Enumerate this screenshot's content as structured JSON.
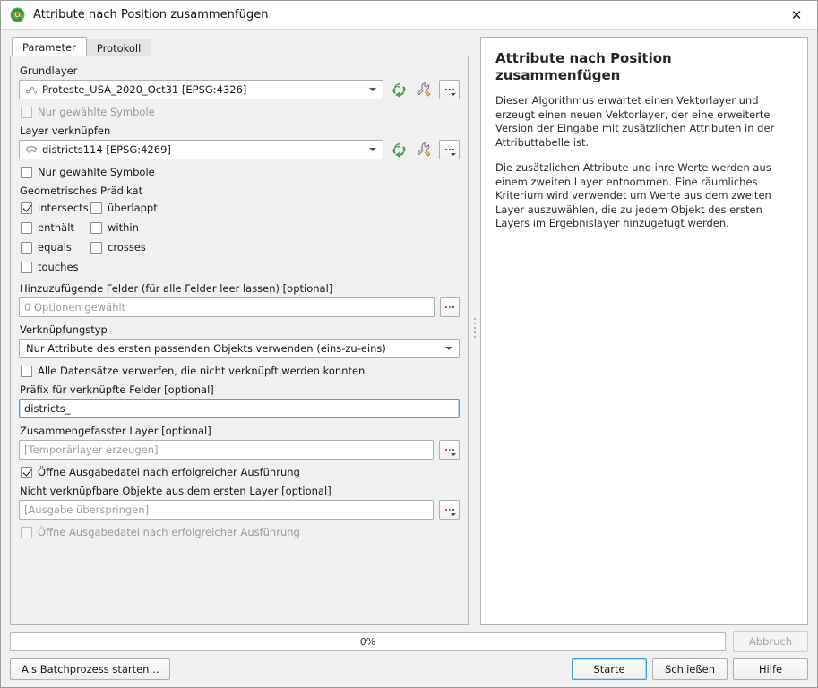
{
  "window": {
    "title": "Attribute nach Position zusammenfügen",
    "icon": "qgis-logo-icon",
    "close_label": "✕"
  },
  "tabs": [
    {
      "label": "Parameter",
      "active": true
    },
    {
      "label": "Protokoll",
      "active": false
    }
  ],
  "parameters": {
    "base_layer": {
      "label": "Grundlayer",
      "value": "Proteste_USA_2020_Oct31 [EPSG:4326]",
      "geometry_icon": "point-layer-icon",
      "refresh_icon": "refresh-icon",
      "expression_icon": "wrench-icon",
      "options_icon": "dots-menu-icon"
    },
    "base_selected_only": {
      "label": "Nur gewählte Symbole",
      "checked": false,
      "disabled": true
    },
    "join_layer": {
      "label": "Layer verknüpfen",
      "value": "districts114 [EPSG:4269]",
      "geometry_icon": "polygon-layer-icon",
      "refresh_icon": "refresh-icon",
      "expression_icon": "wrench-icon",
      "options_icon": "dots-menu-icon"
    },
    "join_selected_only": {
      "label": "Nur gewählte Symbole",
      "checked": false,
      "disabled": false
    },
    "predicate": {
      "label": "Geometrisches Prädikat",
      "items": [
        {
          "label": "intersects",
          "checked": true
        },
        {
          "label": "überlappt",
          "checked": false
        },
        {
          "label": "enthält",
          "checked": false
        },
        {
          "label": "within",
          "checked": false
        },
        {
          "label": "equals",
          "checked": false
        },
        {
          "label": "crosses",
          "checked": false
        },
        {
          "label": "touches",
          "checked": false
        }
      ]
    },
    "fields_to_add": {
      "label": "Hinzuzufügende Felder (für alle Felder leer lassen) [optional]",
      "value": "0 Optionen gewählt",
      "is_placeholder": true,
      "browse_icon": "dots-menu-icon"
    },
    "join_type": {
      "label": "Verknüpfungstyp",
      "value": "Nur Attribute des ersten passenden Objekts verwenden (eins-zu-eins)"
    },
    "discard_unmatched": {
      "label": "Alle Datensätze verwerfen, die nicht verknüpft werden konnten",
      "checked": false,
      "disabled": false
    },
    "prefix": {
      "label": "Präfix für verknüpfte Felder [optional]",
      "value": "districts_",
      "focused": true
    },
    "joined_layer": {
      "label": "Zusammengefasster Layer [optional]",
      "value": "[Temporärlayer erzeugen]",
      "is_placeholder": true,
      "browse_icon": "dots-menu-icon"
    },
    "open_output_1": {
      "label": "Öffne Ausgabedatei nach erfolgreicher Ausführung",
      "checked": true,
      "disabled": false
    },
    "unjoinable": {
      "label": "Nicht verknüpfbare Objekte aus dem ersten Layer [optional]",
      "value": "[Ausgabe überspringen]",
      "is_placeholder": true,
      "browse_icon": "dots-menu-icon"
    },
    "open_output_2": {
      "label": "Öffne Ausgabedatei nach erfolgreicher Ausführung",
      "checked": false,
      "disabled": true
    }
  },
  "splitter": {
    "collapse_icon": "collapse-right-arrow-icon"
  },
  "help": {
    "title": "Attribute nach Position zusammenfügen",
    "paragraph1": "Dieser Algorithmus erwartet einen Vektorlayer und erzeugt einen neuen Vektorlayer, der eine erweiterte Version der Eingabe mit zusätzlichen Attributen in der Attributtabelle ist.",
    "paragraph2": "Die zusätzlichen Attribute und ihre Werte werden aus einem zweiten Layer entnommen. Eine räumliches Kriterium wird verwendet um Werte aus dem zweiten Layer auszuwählen, die zu jedem Objekt des ersten Layers im Ergebnislayer hinzugefügt werden."
  },
  "footer": {
    "progress_text": "0%",
    "progress_value": 0,
    "cancel_label": "Abbruch",
    "cancel_disabled": true,
    "batch_label": "Als Batchprozess starten...",
    "run_label": "Starte",
    "close_label": "Schließen",
    "help_label": "Hilfe"
  },
  "colors": {
    "accent": "#3ea0e0",
    "refresh_green": "#4f9a4f",
    "wrench_gold": "#e8c45a",
    "window_bg": "#f0f0f0",
    "panel_bg": "#ffffff"
  }
}
